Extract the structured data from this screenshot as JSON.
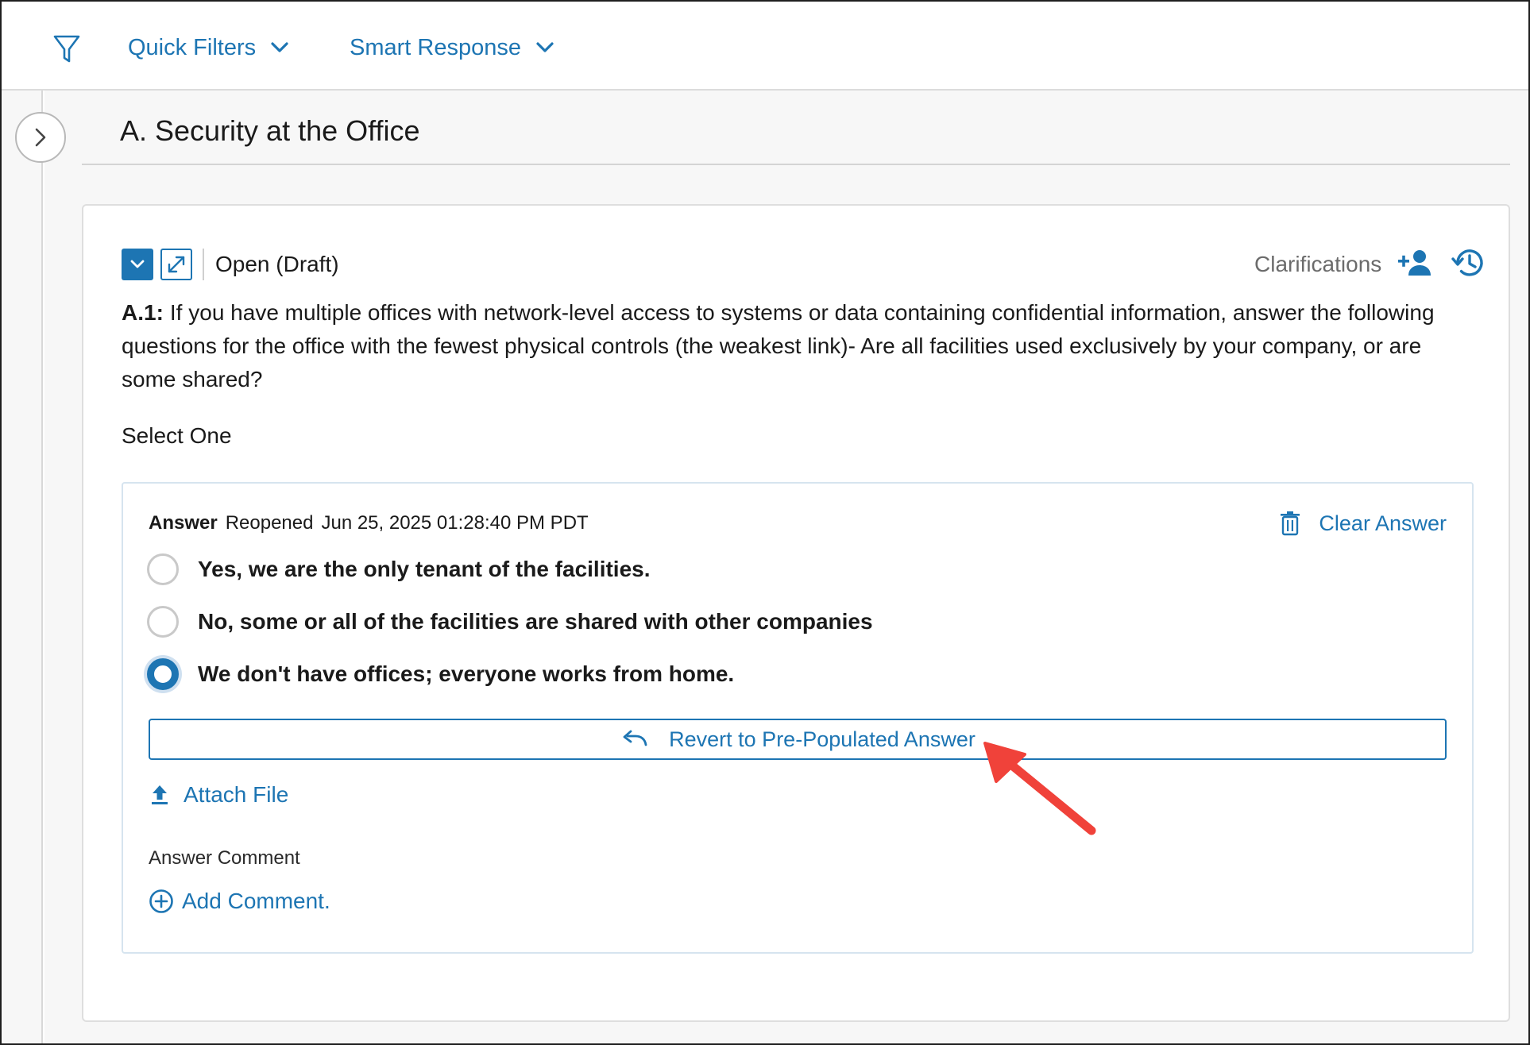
{
  "toolbar": {
    "quick_filters_label": "Quick Filters",
    "smart_response_label": "Smart Response"
  },
  "section": {
    "title": "A. Security at the Office"
  },
  "question": {
    "status": "Open (Draft)",
    "clarifications_label": "Clarifications",
    "id": "A.1:",
    "text": "If you have multiple offices with network-level access to systems or data containing confidential information, answer the following questions for the office with the fewest physical controls (the weakest link)- Are all facilities used exclusively by your company, or are some shared?",
    "instruction": "Select One"
  },
  "answer": {
    "label": "Answer",
    "state": "Reopened",
    "timestamp": "Jun 25, 2025 01:28:40 PM PDT",
    "clear_label": "Clear Answer",
    "options": [
      {
        "label": "Yes, we are the only tenant of the facilities.",
        "selected": false
      },
      {
        "label": "No, some or all of the facilities are shared with other companies",
        "selected": false
      },
      {
        "label": "We don't have offices; everyone works from home.",
        "selected": true
      }
    ],
    "revert_label": "Revert to Pre-Populated Answer",
    "attach_label": "Attach File",
    "comment_label": "Answer Comment",
    "add_comment_label": "Add Comment."
  },
  "colors": {
    "accent": "#1d75b3",
    "annotation": "#f0423a"
  },
  "icons": {
    "filter": "funnel-icon",
    "chevron": "chevron-down-icon",
    "rail_toggle": "chevron-right-icon",
    "collapse": "chevron-down-icon",
    "expand": "expand-diagonal-icon",
    "add_person": "add-person-icon",
    "history": "history-icon",
    "trash": "trash-icon",
    "undo": "undo-icon",
    "upload": "upload-icon",
    "add_circle": "plus-circle-icon"
  }
}
